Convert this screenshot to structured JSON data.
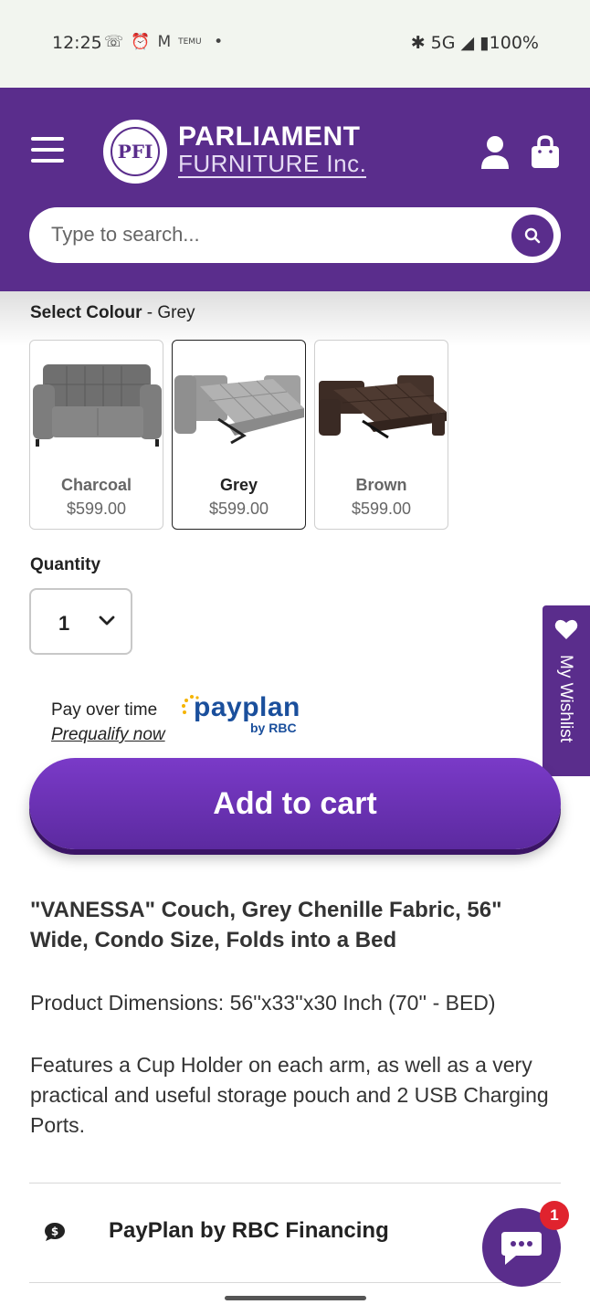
{
  "status_bar": {
    "time": "12:25",
    "left_icons": [
      "missed-call-icon",
      "alarm-icon",
      "gmail-icon",
      "temu-icon",
      "dot-icon"
    ],
    "temu_text": "TEMU",
    "network": "5G",
    "battery": "100%"
  },
  "header": {
    "logo_line1": "PARLIAMENT",
    "logo_line2": "FURNITURE Inc.",
    "logo_monogram": "PFI",
    "brand_color": "#5a2d8c"
  },
  "search": {
    "placeholder": "Type to search..."
  },
  "colour_select": {
    "label": "Select Colour",
    "selected_suffix": " - Grey",
    "options": [
      {
        "name": "Charcoal",
        "price": "$599.00"
      },
      {
        "name": "Grey",
        "price": "$599.00"
      },
      {
        "name": "Brown",
        "price": "$599.00"
      }
    ]
  },
  "quantity": {
    "label": "Quantity",
    "value": "1"
  },
  "wishlist": {
    "label": "My Wishlist"
  },
  "financing": {
    "pay_over_time": "Pay over time",
    "prequalify": "Prequalify now",
    "brand": "payplan",
    "brand_sub": "by RBC"
  },
  "cart": {
    "add_label": "Add to cart"
  },
  "product": {
    "title": "\"VANESSA\" Couch, Grey Chenille Fabric, 56\" Wide, Condo Size, Folds into a Bed",
    "dimensions": "Product Dimensions: 56''x33''x30 Inch (70'' - BED)",
    "features": "Features a Cup Holder on each arm, as well as a very practical and useful storage pouch and 2 USB Charging Ports."
  },
  "accordion": {
    "payplan_label": "PayPlan by RBC Financing"
  },
  "chat": {
    "badge_count": "1"
  }
}
